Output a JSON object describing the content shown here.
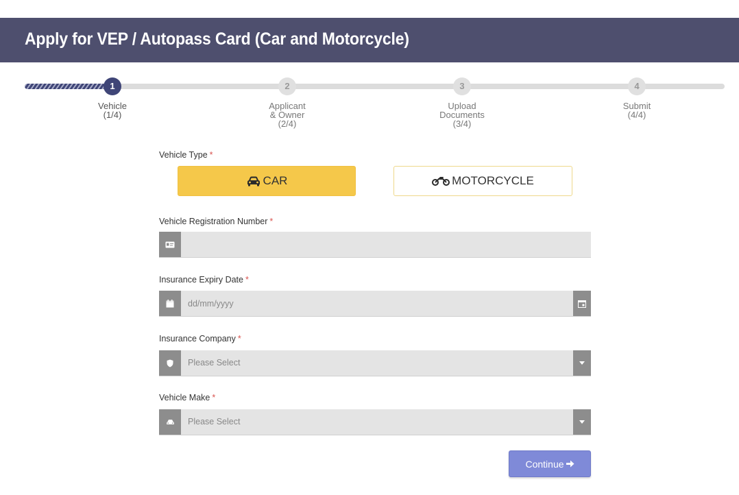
{
  "header": {
    "title": "Apply for VEP / Autopass Card (Car and Motorcycle)"
  },
  "stepper": {
    "steps": [
      {
        "number": "1",
        "line1": "Vehicle",
        "line2": "(1/4)",
        "line3": "",
        "state": "active"
      },
      {
        "number": "2",
        "line1": "Applicant",
        "line2": "& Owner",
        "line3": "(2/4)",
        "state": "pending"
      },
      {
        "number": "3",
        "line1": "Upload",
        "line2": "Documents",
        "line3": "(3/4)",
        "state": "pending"
      },
      {
        "number": "4",
        "line1": "Submit",
        "line2": "(4/4)",
        "line3": "",
        "state": "pending"
      }
    ]
  },
  "form": {
    "vehicle_type": {
      "label": "Vehicle Type",
      "required_mark": "*",
      "options": [
        {
          "label": "CAR",
          "icon": "car-icon",
          "selected": true
        },
        {
          "label": "MOTORCYCLE",
          "icon": "motorcycle-icon",
          "selected": false
        }
      ]
    },
    "registration": {
      "label": "Vehicle Registration Number",
      "required_mark": "*",
      "value": "",
      "icon": "id-card-icon"
    },
    "insurance_expiry": {
      "label": "Insurance Expiry Date",
      "required_mark": "*",
      "placeholder": "dd/mm/yyyy",
      "icon": "calendar-icon",
      "picker_icon": "calendar-picker-icon"
    },
    "insurance_company": {
      "label": "Insurance Company",
      "required_mark": "*",
      "selected": "Please Select",
      "icon": "shield-icon"
    },
    "vehicle_make": {
      "label": "Vehicle Make",
      "required_mark": "*",
      "selected": "Please Select",
      "icon": "car-icon"
    },
    "continue_label": "Continue"
  },
  "colors": {
    "header_bg": "#4e4f6e",
    "step_active": "#3f4577",
    "car_selected": "#f5c84a",
    "required": "#d9534f",
    "continue_bg": "#7f8ad8",
    "addon_bg": "#8d8d8d",
    "input_bg": "#e4e4e4"
  }
}
